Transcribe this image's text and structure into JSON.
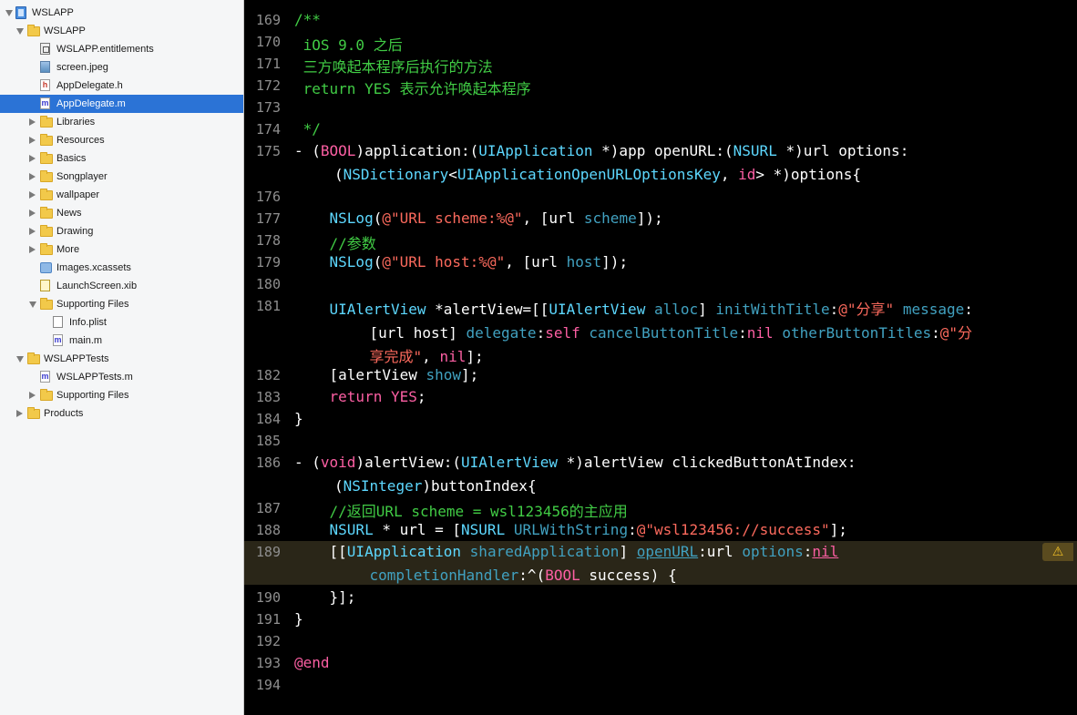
{
  "navigator": {
    "items": [
      {
        "label": "WSLAPP",
        "icon": "project-icon",
        "depth": 0,
        "disclosure": "open"
      },
      {
        "label": "WSLAPP",
        "icon": "folder-icon",
        "depth": 1,
        "disclosure": "open"
      },
      {
        "label": "WSLAPP.entitlements",
        "icon": "entitlements-file-icon",
        "depth": 2,
        "disclosure": "none"
      },
      {
        "label": "screen.jpeg",
        "icon": "image-file-icon",
        "depth": 2,
        "disclosure": "none"
      },
      {
        "label": "AppDelegate.h",
        "icon": "header-file-icon",
        "depth": 2,
        "disclosure": "none",
        "badge": "h"
      },
      {
        "label": "AppDelegate.m",
        "icon": "objc-file-icon",
        "depth": 2,
        "disclosure": "none",
        "badge": "m",
        "selected": true
      },
      {
        "label": "Libraries",
        "icon": "folder-icon",
        "depth": 2,
        "disclosure": "closed"
      },
      {
        "label": "Resources",
        "icon": "folder-icon",
        "depth": 2,
        "disclosure": "closed"
      },
      {
        "label": "Basics",
        "icon": "folder-icon",
        "depth": 2,
        "disclosure": "closed"
      },
      {
        "label": "Songplayer",
        "icon": "folder-icon",
        "depth": 2,
        "disclosure": "closed"
      },
      {
        "label": "wallpaper",
        "icon": "folder-icon",
        "depth": 2,
        "disclosure": "closed"
      },
      {
        "label": "News",
        "icon": "folder-icon",
        "depth": 2,
        "disclosure": "closed"
      },
      {
        "label": "Drawing",
        "icon": "folder-icon",
        "depth": 2,
        "disclosure": "closed"
      },
      {
        "label": "More",
        "icon": "folder-icon",
        "depth": 2,
        "disclosure": "closed"
      },
      {
        "label": "Images.xcassets",
        "icon": "asset-catalog-icon",
        "depth": 2,
        "disclosure": "none"
      },
      {
        "label": "LaunchScreen.xib",
        "icon": "xib-file-icon",
        "depth": 2,
        "disclosure": "none"
      },
      {
        "label": "Supporting Files",
        "icon": "folder-icon",
        "depth": 2,
        "disclosure": "open"
      },
      {
        "label": "Info.plist",
        "icon": "plist-file-icon",
        "depth": 3,
        "disclosure": "none"
      },
      {
        "label": "main.m",
        "icon": "objc-file-icon",
        "depth": 3,
        "disclosure": "none",
        "badge": "m"
      },
      {
        "label": "WSLAPPTests",
        "icon": "folder-icon",
        "depth": 1,
        "disclosure": "open"
      },
      {
        "label": "WSLAPPTests.m",
        "icon": "objc-file-icon",
        "depth": 2,
        "disclosure": "none",
        "badge": "m"
      },
      {
        "label": "Supporting Files",
        "icon": "folder-icon",
        "depth": 2,
        "disclosure": "closed"
      },
      {
        "label": "Products",
        "icon": "folder-icon",
        "depth": 1,
        "disclosure": "closed"
      }
    ]
  },
  "editor": {
    "colors": {
      "comment": "#41cc45",
      "keyword": "#fc5fa3",
      "type": "#5dd8ff",
      "method": "#41a1c0",
      "string": "#fc6a5d",
      "text": "#ffffff",
      "line_number": "#8e8e8e",
      "highlight": "#2a2618",
      "warning": "#f2c027"
    },
    "warning_icon": "warning-triangle-icon",
    "highlighted_line": "189",
    "lines": [
      {
        "num": "169",
        "tokens": [
          [
            "cm",
            "/**"
          ]
        ]
      },
      {
        "num": "170",
        "tokens": [
          [
            "cm",
            " iOS 9.0 之后"
          ]
        ]
      },
      {
        "num": "171",
        "tokens": [
          [
            "cm",
            " 三方唤起本程序后执行的方法"
          ]
        ]
      },
      {
        "num": "172",
        "tokens": [
          [
            "cm",
            " return YES 表示允许唤起本程序"
          ]
        ]
      },
      {
        "num": "173",
        "tokens": []
      },
      {
        "num": "174",
        "tokens": [
          [
            "cm",
            " */"
          ]
        ]
      },
      {
        "num": "175",
        "tokens": [
          [
            "tx",
            "- ("
          ],
          [
            "kw",
            "BOOL"
          ],
          [
            "tx",
            ")application:("
          ],
          [
            "ty",
            "UIApplication"
          ],
          [
            "tx",
            " *)app openURL:("
          ],
          [
            "ty",
            "NSURL"
          ],
          [
            "tx",
            " *)url options:"
          ]
        ],
        "wrap": [
          [
            [
              "tx",
              "("
            ],
            [
              "ty",
              "NSDictionary"
            ],
            [
              "tx",
              "<"
            ],
            [
              "ty",
              "UIApplicationOpenURLOptionsKey"
            ],
            [
              "tx",
              ", "
            ],
            [
              "kw",
              "id"
            ],
            [
              "tx",
              "> *)options{"
            ]
          ]
        ]
      },
      {
        "num": "176",
        "tokens": []
      },
      {
        "num": "177",
        "tokens": [
          [
            "tx",
            "    "
          ],
          [
            "ty",
            "NSLog"
          ],
          [
            "tx",
            "("
          ],
          [
            "st",
            "@\"URL scheme:%@\""
          ],
          [
            "tx",
            ", [url "
          ],
          [
            "mt",
            "scheme"
          ],
          [
            "tx",
            "]);"
          ]
        ]
      },
      {
        "num": "178",
        "tokens": [
          [
            "cm",
            "    //参数"
          ]
        ]
      },
      {
        "num": "179",
        "tokens": [
          [
            "tx",
            "    "
          ],
          [
            "ty",
            "NSLog"
          ],
          [
            "tx",
            "("
          ],
          [
            "st",
            "@\"URL host:%@\""
          ],
          [
            "tx",
            ", [url "
          ],
          [
            "mt",
            "host"
          ],
          [
            "tx",
            "]);"
          ]
        ]
      },
      {
        "num": "180",
        "tokens": []
      },
      {
        "num": "181",
        "tokens": [
          [
            "tx",
            "    "
          ],
          [
            "ty",
            "UIAlertView"
          ],
          [
            "tx",
            " *alertView=[["
          ],
          [
            "ty",
            "UIAlertView"
          ],
          [
            "tx",
            " "
          ],
          [
            "mt",
            "alloc"
          ],
          [
            "tx",
            "] "
          ],
          [
            "mt",
            "initWithTitle"
          ],
          [
            "tx",
            ":"
          ],
          [
            "st",
            "@\"分享\""
          ],
          [
            "tx",
            " "
          ],
          [
            "mt",
            "message"
          ],
          [
            "tx",
            ":"
          ]
        ],
        "wrap": [
          [
            [
              "tx",
              "    [url host] "
            ],
            [
              "mt",
              "delegate"
            ],
            [
              "tx",
              ":"
            ],
            [
              "kw",
              "self"
            ],
            [
              "tx",
              " "
            ],
            [
              "mt",
              "cancelButtonTitle"
            ],
            [
              "tx",
              ":"
            ],
            [
              "kw",
              "nil"
            ],
            [
              "tx",
              " "
            ],
            [
              "mt",
              "otherButtonTitles"
            ],
            [
              "tx",
              ":"
            ],
            [
              "st",
              "@\"分"
            ]
          ],
          [
            [
              "st",
              "    享完成\""
            ],
            [
              "tx",
              ", "
            ],
            [
              "kw",
              "nil"
            ],
            [
              "tx",
              "];"
            ]
          ]
        ]
      },
      {
        "num": "182",
        "tokens": [
          [
            "tx",
            "    [alertView "
          ],
          [
            "mt",
            "show"
          ],
          [
            "tx",
            "];"
          ]
        ]
      },
      {
        "num": "183",
        "tokens": [
          [
            "tx",
            "    "
          ],
          [
            "kw",
            "return"
          ],
          [
            "tx",
            " "
          ],
          [
            "kw",
            "YES"
          ],
          [
            "tx",
            ";"
          ]
        ]
      },
      {
        "num": "184",
        "tokens": [
          [
            "tx",
            "}"
          ]
        ]
      },
      {
        "num": "185",
        "tokens": []
      },
      {
        "num": "186",
        "tokens": [
          [
            "tx",
            "- ("
          ],
          [
            "kw",
            "void"
          ],
          [
            "tx",
            ")alertView:("
          ],
          [
            "ty",
            "UIAlertView"
          ],
          [
            "tx",
            " *)alertView clickedButtonAtIndex:"
          ]
        ],
        "wrap": [
          [
            [
              "tx",
              "("
            ],
            [
              "ty",
              "NSInteger"
            ],
            [
              "tx",
              ")buttonIndex{"
            ]
          ]
        ]
      },
      {
        "num": "187",
        "tokens": [
          [
            "cm",
            "    //返回URL scheme = wsl123456的主应用"
          ]
        ]
      },
      {
        "num": "188",
        "tokens": [
          [
            "tx",
            "    "
          ],
          [
            "ty",
            "NSURL"
          ],
          [
            "tx",
            " * url = ["
          ],
          [
            "ty",
            "NSURL"
          ],
          [
            "tx",
            " "
          ],
          [
            "mt",
            "URLWithString"
          ],
          [
            "tx",
            ":"
          ],
          [
            "st",
            "@\"wsl123456://success\""
          ],
          [
            "tx",
            "];"
          ]
        ]
      },
      {
        "num": "189",
        "tokens": [
          [
            "tx",
            "    [["
          ],
          [
            "ty",
            "UIApplication"
          ],
          [
            "tx",
            " "
          ],
          [
            "mt",
            "sharedApplication"
          ],
          [
            "tx",
            "] "
          ],
          [
            "mt ul",
            "openURL"
          ],
          [
            "tx",
            ":url "
          ],
          [
            "mt",
            "options"
          ],
          [
            "tx",
            ":"
          ],
          [
            "kw ul",
            "nil"
          ]
        ],
        "wrap": [
          [
            [
              "tx",
              "    "
            ],
            [
              "mt",
              "completionHandler"
            ],
            [
              "tx",
              ":^("
            ],
            [
              "kw",
              "BOOL"
            ],
            [
              "tx",
              " success) {"
            ]
          ]
        ]
      },
      {
        "num": "190",
        "tokens": [
          [
            "tx",
            "    }];"
          ]
        ]
      },
      {
        "num": "191",
        "tokens": [
          [
            "tx",
            "}"
          ]
        ]
      },
      {
        "num": "192",
        "tokens": []
      },
      {
        "num": "193",
        "tokens": [
          [
            "kw",
            "@end"
          ]
        ]
      },
      {
        "num": "194",
        "tokens": []
      }
    ]
  }
}
